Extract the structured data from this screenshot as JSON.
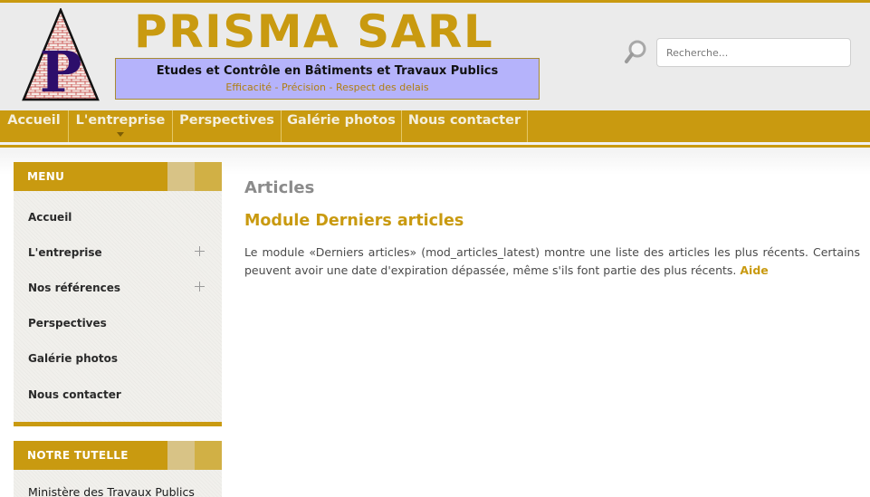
{
  "header": {
    "brand_name": "PRISMA SARL",
    "tagline": "Etudes et Contrôle en Bâtiments et Travaux Publics",
    "motto": "Efficacité - Précision - Respect des delais",
    "logo_letter": "P",
    "search": {
      "placeholder": "Recherche...",
      "value": ""
    }
  },
  "nav": {
    "items": [
      {
        "label": "Accueil"
      },
      {
        "label": "L'entreprise",
        "has_dropdown": true
      },
      {
        "label": "Perspectives"
      },
      {
        "label": "Galérie photos"
      },
      {
        "label": "Nous contacter"
      }
    ]
  },
  "sidebar": {
    "menu": {
      "title": "MENU",
      "items": [
        {
          "label": "Accueil"
        },
        {
          "label": "L'entreprise",
          "expandable": true
        },
        {
          "label": "Nos références",
          "expandable": true
        },
        {
          "label": "Perspectives"
        },
        {
          "label": "Galérie photos"
        },
        {
          "label": "Nous contacter"
        }
      ]
    },
    "tutelle": {
      "title": "NOTRE TUTELLE",
      "items": [
        {
          "label": "Ministère des Travaux Publics"
        }
      ]
    }
  },
  "main": {
    "heading": "Articles",
    "subheading": "Module Derniers articles",
    "body": "Le module «Derniers articles» (mod_articles_latest) montre une liste des articles les plus récents. Certains peuvent avoir une date d'expiration dépassée, même s'ils font partie des plus récents.",
    "help_link": "Aide"
  },
  "colors": {
    "accent_gold": "#c99a10",
    "tagline_box": "#b5b3fb",
    "header_bg": "#ebebeb",
    "logo_letter": "#2d0e6b",
    "logo_brick": "#c23b3b"
  },
  "icons": {
    "search": "magnifier-icon",
    "expand": "plus-icon",
    "dropdown": "caret-down-icon"
  }
}
